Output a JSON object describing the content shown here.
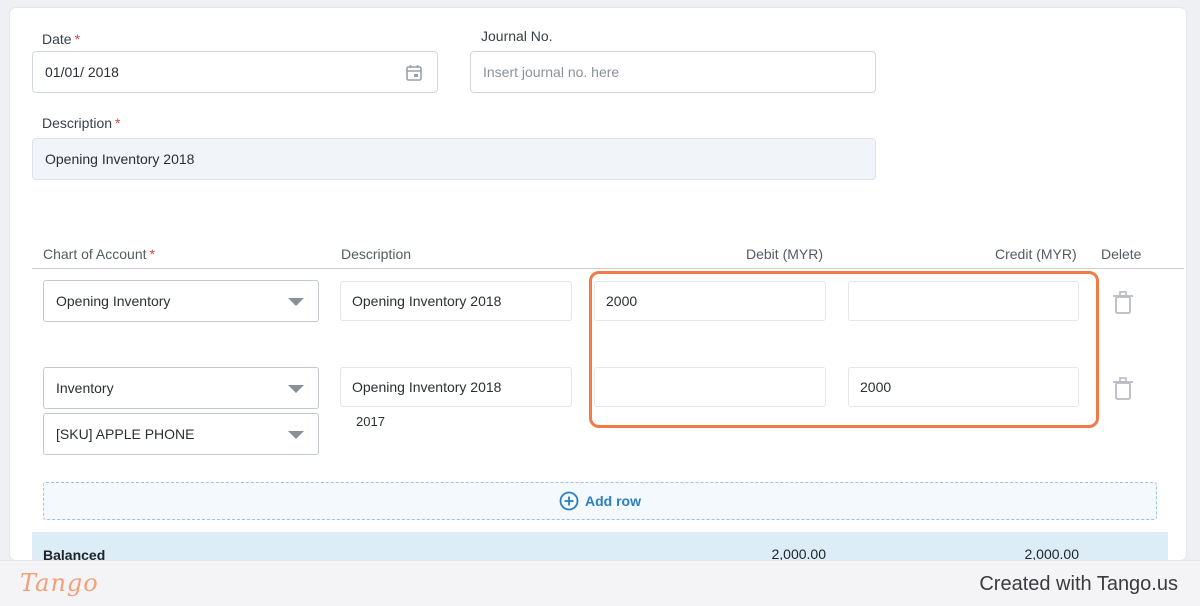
{
  "form": {
    "date_label": "Date",
    "date_value": "01/01/ 2018",
    "journal_label": "Journal No.",
    "journal_placeholder": "Insert journal no. here",
    "description_label": "Description",
    "description_value": "Opening Inventory  2018",
    "required_mark": "*"
  },
  "table": {
    "headers": {
      "account": "Chart of Account",
      "description": "Description",
      "debit": "Debit (MYR)",
      "credit": "Credit (MYR)",
      "delete": "Delete"
    },
    "rows": [
      {
        "account": "Opening Inventory",
        "description": "Opening Inventory  2018",
        "debit": "2000",
        "credit": ""
      },
      {
        "account": "Inventory",
        "sku": "[SKU] APPLE PHONE",
        "description": "Opening Inventory  2018",
        "note": "2017",
        "debit": "",
        "credit": "2000"
      }
    ],
    "add_row_label": "Add row"
  },
  "summary": {
    "label": "Balanced",
    "debit_total": "2,000.00",
    "credit_total": "2,000.00"
  },
  "footer": {
    "logo": "Tango",
    "created_text": "Created with Tango.us"
  },
  "colors": {
    "highlight": "#f27a46",
    "accent": "#2a7fc1",
    "required": "#d64545"
  }
}
